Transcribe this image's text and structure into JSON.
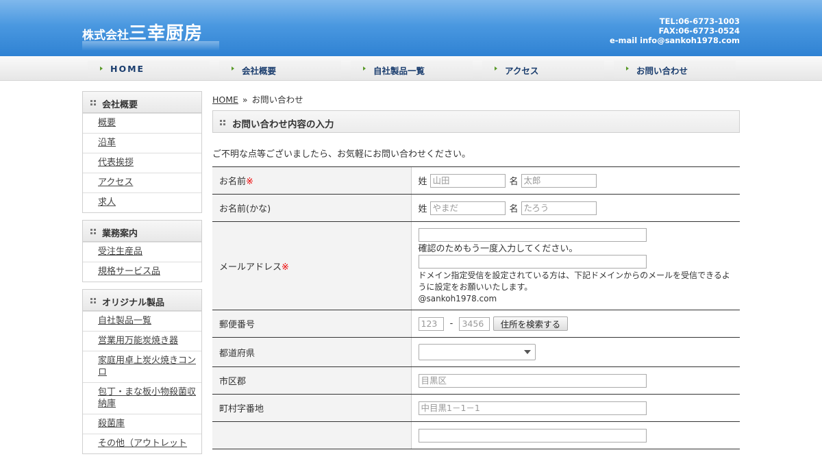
{
  "header": {
    "logo_small": "株式会社",
    "logo_big": "三幸厨房",
    "tel": "TEL:06-6773-1003",
    "fax": "FAX:06-6773-0524",
    "email": "e-mail info@sankoh1978.com"
  },
  "nav": {
    "items": [
      {
        "label": "HOME"
      },
      {
        "label": "会社概要"
      },
      {
        "label": "自社製品一覧"
      },
      {
        "label": "アクセス"
      },
      {
        "label": "お問い合わせ"
      }
    ]
  },
  "sidebar": {
    "sections": [
      {
        "title": "会社概要",
        "items": [
          "概要",
          "沿革",
          "代表挨拶",
          "アクセス",
          "求人"
        ]
      },
      {
        "title": "業務案内",
        "items": [
          "受注生産品",
          "規格サービス品"
        ]
      },
      {
        "title": "オリジナル製品",
        "items": [
          "自社製品一覧",
          "営業用万能炭焼き器",
          "家庭用卓上炭火焼きコンロ",
          "包丁・まな板小物殺菌収納庫",
          "殺菌庫",
          "その他（アウトレット"
        ]
      }
    ]
  },
  "main": {
    "breadcrumb": {
      "home": "HOME",
      "sep": "»",
      "current": "お問い合わせ"
    },
    "title": "お問い合わせ内容の入力",
    "intro": "ご不明な点等ございましたら、お気軽にお問い合わせください。",
    "form": {
      "required_mark": "※",
      "name": {
        "label": "お名前",
        "sei": "姓",
        "mei": "名",
        "sei_placeholder": "山田",
        "mei_placeholder": "太郎"
      },
      "kana": {
        "label": "お名前(かな)",
        "sei": "姓",
        "mei": "名",
        "sei_placeholder": "やまだ",
        "mei_placeholder": "たろう"
      },
      "email": {
        "label": "メールアドレス",
        "confirm_note": "確認のためもう一度入力してください。",
        "domain_note": "ドメイン指定受信を設定されている方は、下記ドメインからのメールを受信できるように設定をお願いいたします。",
        "domain": "@sankoh1978.com"
      },
      "zip": {
        "label": "郵便番号",
        "p1_placeholder": "123",
        "dash": "-",
        "p2_placeholder": "3456",
        "button": "住所を検索する"
      },
      "pref": {
        "label": "都道府県",
        "value": ""
      },
      "city": {
        "label": "市区郡",
        "placeholder": "目黒区"
      },
      "town": {
        "label": "町村字番地",
        "placeholder": "中目黒1－1－1"
      }
    }
  }
}
